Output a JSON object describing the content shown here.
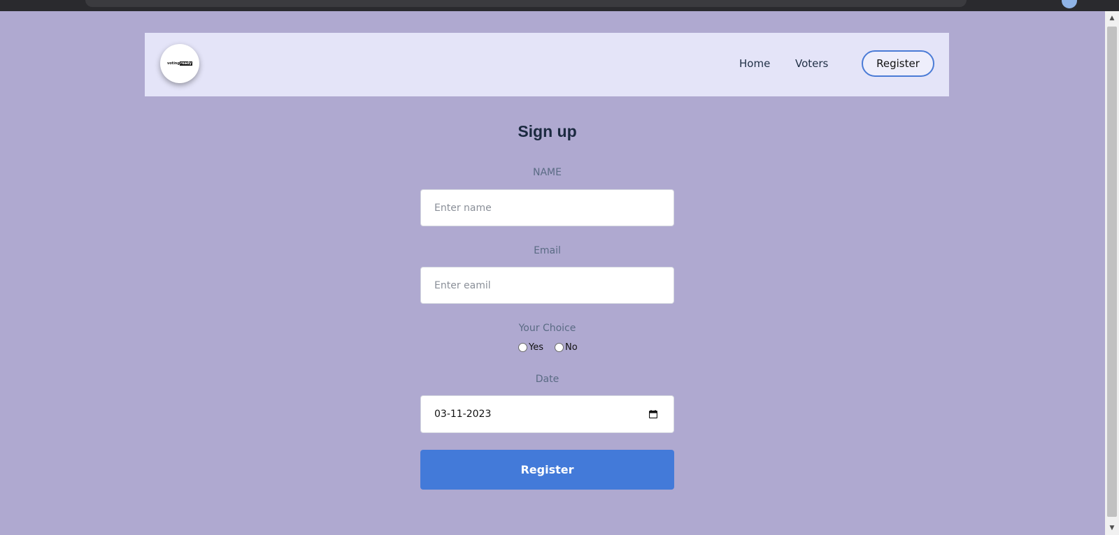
{
  "navbar": {
    "logo_text_left": "voting",
    "logo_text_right": "ready",
    "links": {
      "home": "Home",
      "voters": "Voters"
    },
    "register_label": "Register"
  },
  "form": {
    "title": "Sign up",
    "name": {
      "label": "NAME",
      "placeholder": "Enter name",
      "value": ""
    },
    "email": {
      "label": "Email",
      "placeholder": "Enter eamil",
      "value": ""
    },
    "choice": {
      "label": "Your Choice",
      "options": [
        "Yes",
        "No"
      ],
      "selected": null
    },
    "date": {
      "label": "Date",
      "value": "03-11-2023"
    },
    "submit_label": "Register"
  },
  "colors": {
    "page_background": "#afa9d0",
    "navbar_background": "#e4e4f8",
    "accent": "#437ad9"
  },
  "icons": {
    "calendar": "calendar-icon",
    "scroll_up": "scroll-up-arrow-icon",
    "scroll_down": "scroll-down-arrow-icon"
  }
}
